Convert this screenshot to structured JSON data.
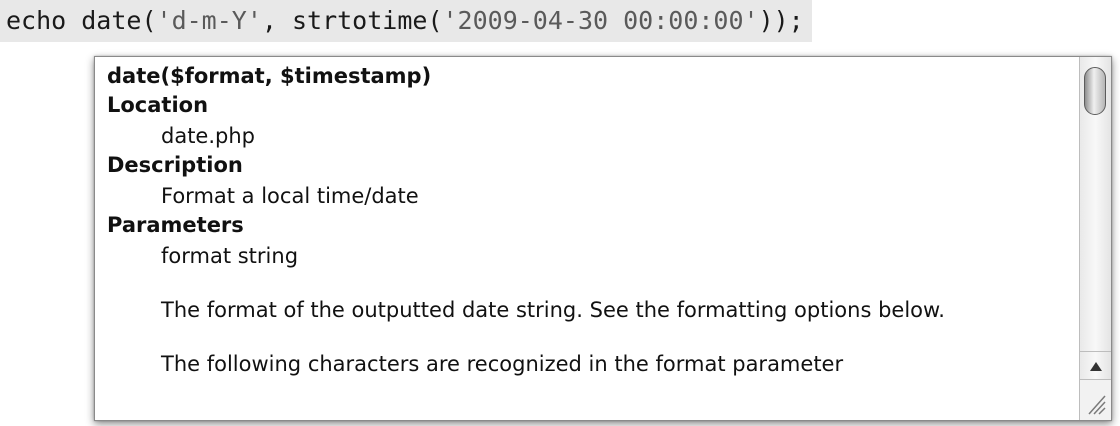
{
  "code": {
    "tokens": [
      {
        "text": "echo date(",
        "kind": "plain"
      },
      {
        "text": "'d-m-Y'",
        "kind": "string"
      },
      {
        "text": ", strtotime(",
        "kind": "plain"
      },
      {
        "text": "'2009-04-30 00:00:00'",
        "kind": "string"
      },
      {
        "text": "));",
        "kind": "plain"
      }
    ]
  },
  "popup": {
    "signature": "date($format, $timestamp)",
    "location_heading": "Location",
    "location_value": "date.php",
    "description_heading": "Description",
    "description_value": "Format a local time/date",
    "parameters_heading": "Parameters",
    "param_name": "format string",
    "param_desc": "The format of the outputted date string. See the formatting options below.",
    "more_text": "The following characters are recognized in the format parameter"
  },
  "icons": {
    "scroll_thumb": "scrollbar-thumb",
    "scroll_up": "arrow-up-icon",
    "resize": "resize-grip-icon"
  }
}
